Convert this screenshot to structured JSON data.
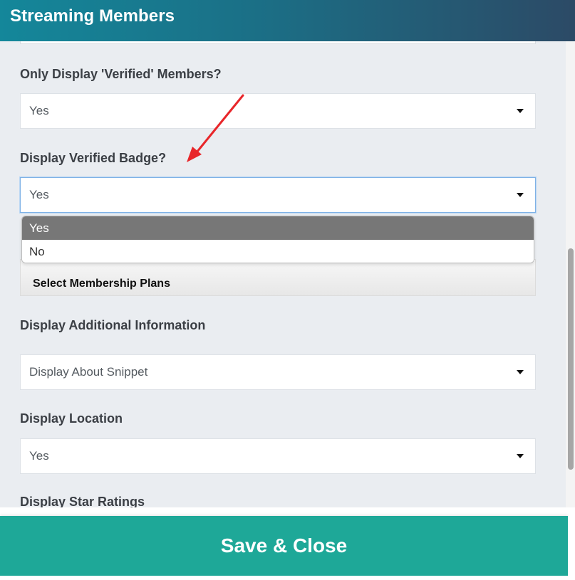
{
  "header": {
    "title": "Streaming Members"
  },
  "fields": {
    "verified_only": {
      "label": "Only Display 'Verified' Members?",
      "value": "Yes"
    },
    "verified_badge": {
      "label": "Display Verified Badge?",
      "value": "Yes",
      "options": [
        "Yes",
        "No"
      ],
      "selected": "Yes"
    },
    "membership_plans": {
      "value": "Select Membership Plans"
    },
    "additional_info": {
      "label": "Display Additional Information",
      "value": "Display About Snippet"
    },
    "location": {
      "label": "Display Location",
      "value": "Yes"
    },
    "star_ratings": {
      "label": "Display Star Ratings"
    }
  },
  "footer": {
    "save_label": "Save & Close"
  },
  "colors": {
    "header_start": "#14879a",
    "header_end": "#2c4a66",
    "save_button": "#1ea898",
    "annotation_arrow": "#e8262a",
    "dropdown_selected": "#777777"
  },
  "icons": {
    "select_caret": "caret-down-icon",
    "annotation": "red-arrow-annotation"
  }
}
